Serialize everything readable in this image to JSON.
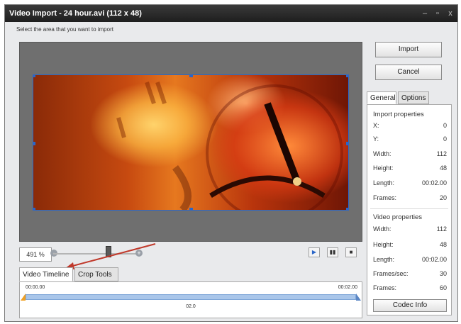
{
  "window": {
    "title": "Video Import - 24 hour.avi  (112 x 48)"
  },
  "instruction": "Select the area that you want to import",
  "buttons": {
    "import": "Import",
    "cancel": "Cancel"
  },
  "zoom": {
    "value": "491 %",
    "minus": "-",
    "plus": "+"
  },
  "right_tabs": [
    "General",
    "Options"
  ],
  "bottom_tabs": [
    "Video Timeline",
    "Crop Tools"
  ],
  "timeline": {
    "start": "00:00.00",
    "end": "00:02.00",
    "mid": "02.0"
  },
  "import_properties": {
    "title": "Import properties",
    "items": [
      {
        "label": "X:",
        "value": "0"
      },
      {
        "label": "Y:",
        "value": "0"
      },
      {
        "label": "Width:",
        "value": "112"
      },
      {
        "label": "Height:",
        "value": "48"
      },
      {
        "label": "Length:",
        "value": "00:02.00"
      },
      {
        "label": "Frames:",
        "value": "20"
      }
    ]
  },
  "video_properties": {
    "title": "Video properties",
    "items": [
      {
        "label": "Width:",
        "value": "112"
      },
      {
        "label": "Height:",
        "value": "48"
      },
      {
        "label": "Length:",
        "value": "00:02.00"
      },
      {
        "label": "Frames/sec:",
        "value": "30"
      },
      {
        "label": "Frames:",
        "value": "60"
      }
    ]
  },
  "codec_button": "Codec Info",
  "colors": {
    "accent": "#2b66c8",
    "arrow": "#c0392b"
  }
}
